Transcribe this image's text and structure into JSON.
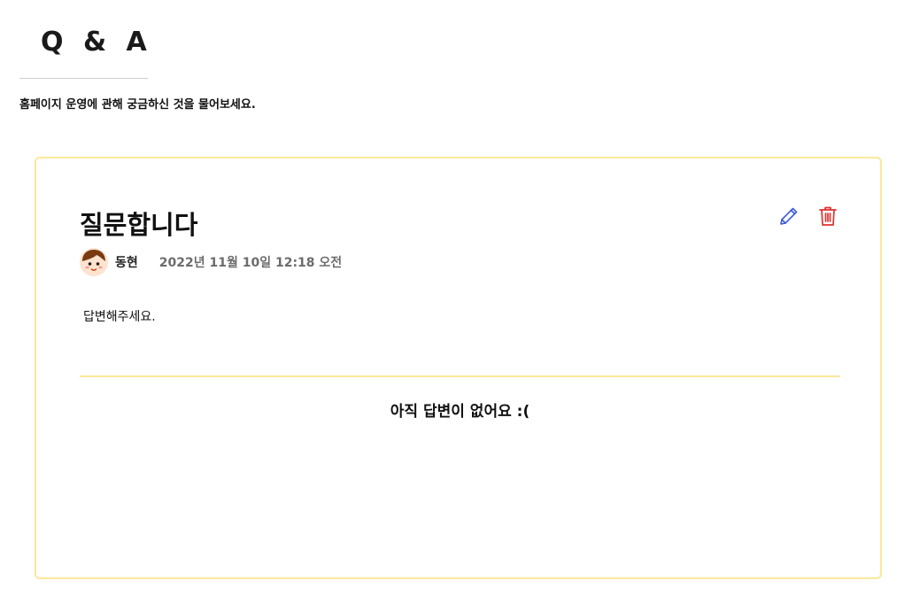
{
  "header": {
    "title": "Q & A",
    "description": "홈페이지 운영에 관해 궁금하신 것을 물어보세요."
  },
  "question": {
    "title": "질문합니다",
    "author": "동현",
    "date": "2022년 11월 10일 12:18 오전",
    "body": "답변해주세요.",
    "avatar_icon": "user-avatar-icon",
    "edit_icon": "pencil-icon",
    "delete_icon": "trash-icon"
  },
  "answer": {
    "empty_message": "아직 답변이 없어요 :("
  },
  "colors": {
    "card_border": "#fbe89a",
    "edit_icon": "#3b5bdb",
    "delete_icon": "#e03131",
    "date_text": "#6c6c6c"
  }
}
